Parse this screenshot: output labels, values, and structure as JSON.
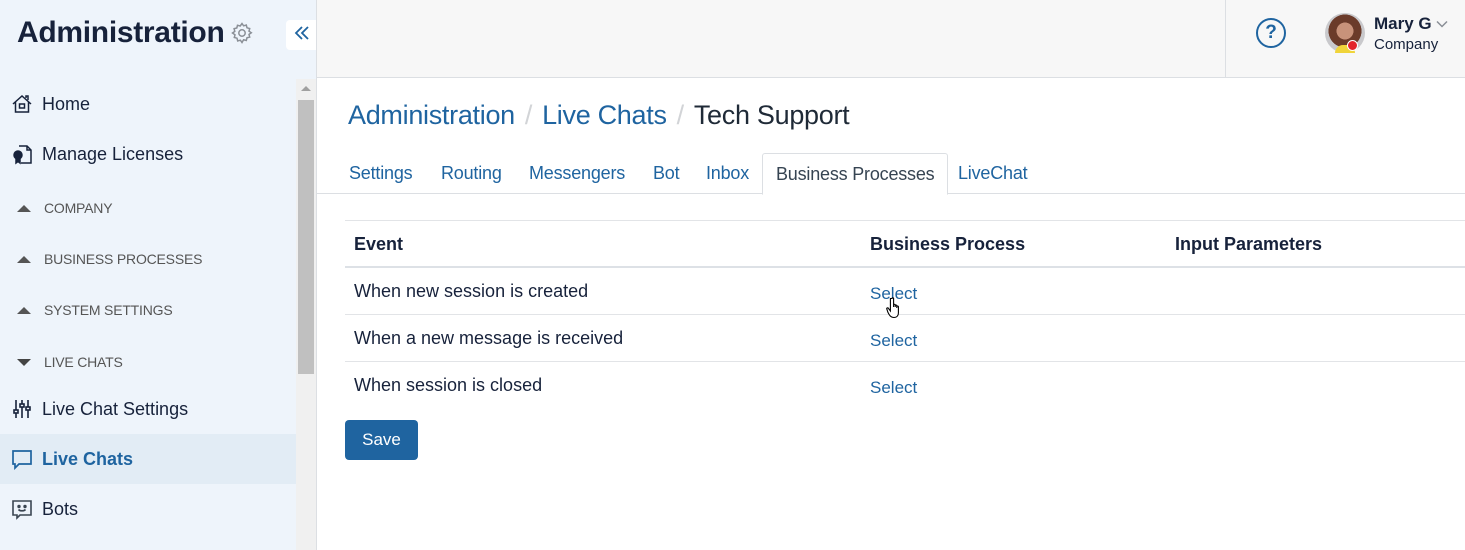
{
  "sidebar": {
    "title": "Administration",
    "title_icon": "gear-icon",
    "collapse_icon": "double-chevron-left-icon",
    "items": [
      {
        "label": "Home",
        "icon": "home-icon"
      },
      {
        "label": "Manage Licenses",
        "icon": "license-icon"
      }
    ],
    "groups": [
      {
        "label": "COMPANY",
        "state": "collapsed"
      },
      {
        "label": "BUSINESS PROCESSES",
        "state": "collapsed"
      },
      {
        "label": "SYSTEM SETTINGS",
        "state": "collapsed"
      },
      {
        "label": "LIVE CHATS",
        "state": "expanded"
      }
    ],
    "live_chat_items": [
      {
        "label": "Live Chat Settings",
        "icon": "sliders-icon",
        "active": false
      },
      {
        "label": "Live Chats",
        "icon": "chat-bubble-icon",
        "active": true
      },
      {
        "label": "Bots",
        "icon": "bot-icon",
        "active": false
      }
    ]
  },
  "topbar": {
    "help_label": "?",
    "user": {
      "name": "Mary G",
      "company": "Company",
      "status": "busy"
    }
  },
  "breadcrumb": {
    "items": [
      "Administration",
      "Live Chats"
    ],
    "current": "Tech Support",
    "separator": "/"
  },
  "tabs": [
    {
      "label": "Settings",
      "active": false
    },
    {
      "label": "Routing",
      "active": false
    },
    {
      "label": "Messengers",
      "active": false
    },
    {
      "label": "Bot",
      "active": false
    },
    {
      "label": "Inbox",
      "active": false
    },
    {
      "label": "Business Processes",
      "active": true
    },
    {
      "label": "LiveChat",
      "active": false
    }
  ],
  "table": {
    "columns": [
      "Event",
      "Business Process",
      "Input Parameters"
    ],
    "rows": [
      {
        "event": "When new session is created",
        "process": "Select",
        "params": ""
      },
      {
        "event": "When a new message is received",
        "process": "Select",
        "params": ""
      },
      {
        "event": "When session is closed",
        "process": "Select",
        "params": ""
      }
    ]
  },
  "actions": {
    "save_label": "Save"
  },
  "colors": {
    "accent": "#1f64a0",
    "sidebar_bg": "#eef4fb",
    "status_busy": "#e3242b"
  }
}
